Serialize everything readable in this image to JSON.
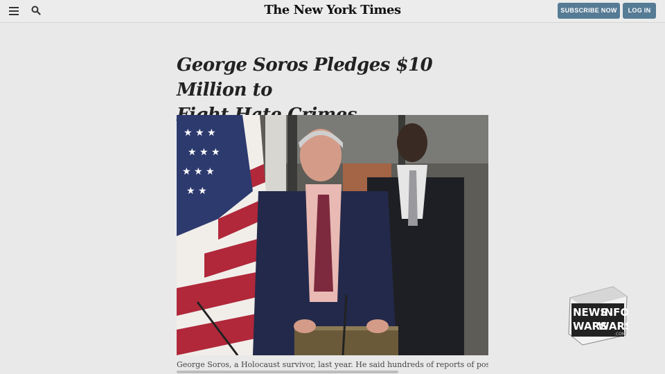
{
  "header": {
    "masthead": "The New York Times",
    "subscribe_label": "SUBSCRIBE NOW",
    "login_label": "LOG IN"
  },
  "article": {
    "headline_line1": "George Soros Pledges $10 Million to",
    "headline_line2": "Fight Hate Crimes",
    "caption": "George Soros, a Holocaust survivor, last year. He said hundreds of reports of possible"
  },
  "watermark": {
    "line1_a": "NEWS",
    "line1_b": "INFO",
    "line2_a": "WARS",
    "line2_b": "WARS",
    "suffix": ".COM"
  },
  "colors": {
    "button": "#567b95",
    "background": "#e9e9e9",
    "flag_red": "#b0283a",
    "flag_blue": "#2d3a6e"
  },
  "icons": [
    "menu-icon",
    "search-icon"
  ]
}
